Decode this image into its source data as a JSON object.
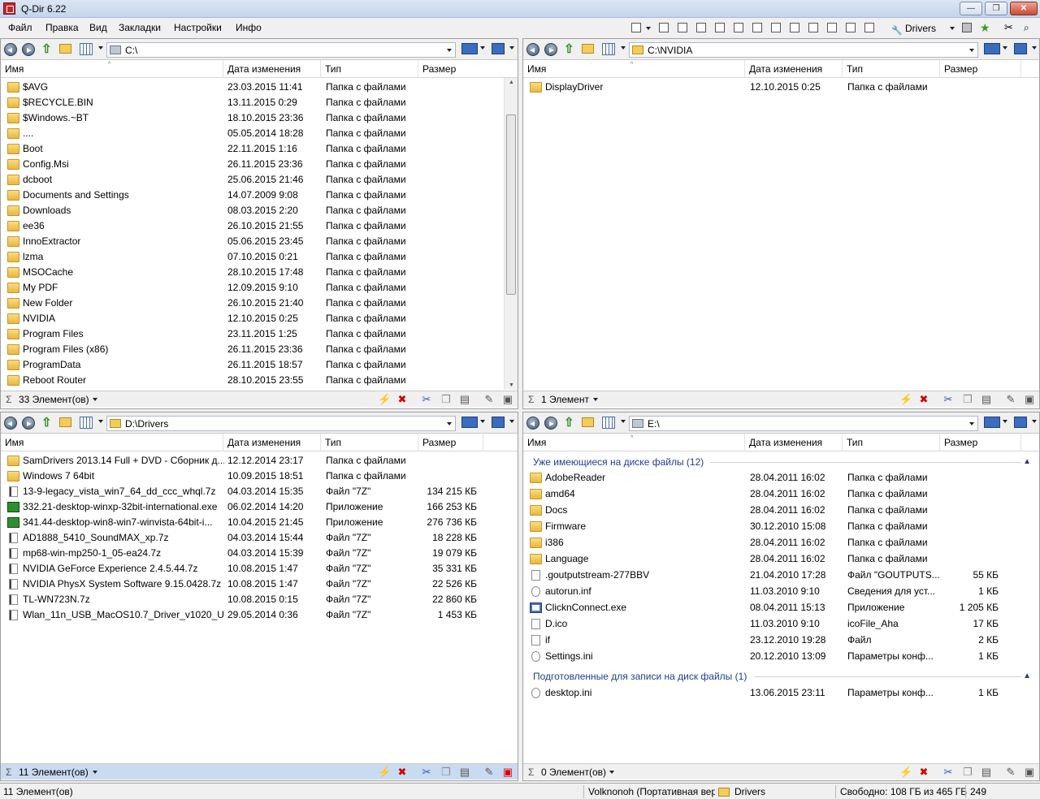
{
  "window": {
    "title": "Q-Dir 6.22"
  },
  "menu": {
    "items": [
      "Файл",
      "Правка",
      "Вид",
      "Закладки",
      "Настройки",
      "Инфо"
    ]
  },
  "toolbar": {
    "bookmark_label": "Drivers"
  },
  "columns": {
    "name": "Имя",
    "date": "Дата изменения",
    "type": "Тип",
    "size": "Размер"
  },
  "panels": {
    "top_left": {
      "path": "C:\\",
      "status": "33 Элемент(ов)",
      "rows": [
        {
          "name": "$AVG",
          "date": "23.03.2015 11:41",
          "type": "Папка с файлами",
          "size": "",
          "icon": "folder"
        },
        {
          "name": "$RECYCLE.BIN",
          "date": "13.11.2015 0:29",
          "type": "Папка с файлами",
          "size": "",
          "icon": "folder"
        },
        {
          "name": "$Windows.~BT",
          "date": "18.10.2015 23:36",
          "type": "Папка с файлами",
          "size": "",
          "icon": "folder"
        },
        {
          "name": "....",
          "date": "05.05.2014 18:28",
          "type": "Папка с файлами",
          "size": "",
          "icon": "folder"
        },
        {
          "name": "Boot",
          "date": "22.11.2015 1:16",
          "type": "Папка с файлами",
          "size": "",
          "icon": "folder"
        },
        {
          "name": "Config.Msi",
          "date": "26.11.2015 23:36",
          "type": "Папка с файлами",
          "size": "",
          "icon": "folder"
        },
        {
          "name": "dcboot",
          "date": "25.06.2015 21:46",
          "type": "Папка с файлами",
          "size": "",
          "icon": "folder"
        },
        {
          "name": "Documents and Settings",
          "date": "14.07.2009 9:08",
          "type": "Папка с файлами",
          "size": "",
          "icon": "folder"
        },
        {
          "name": "Downloads",
          "date": "08.03.2015 2:20",
          "type": "Папка с файлами",
          "size": "",
          "icon": "folder"
        },
        {
          "name": "ee36",
          "date": "26.10.2015 21:55",
          "type": "Папка с файлами",
          "size": "",
          "icon": "folder"
        },
        {
          "name": "InnoExtractor",
          "date": "05.06.2015 23:45",
          "type": "Папка с файлами",
          "size": "",
          "icon": "folder"
        },
        {
          "name": "lzma",
          "date": "07.10.2015 0:21",
          "type": "Папка с файлами",
          "size": "",
          "icon": "folder"
        },
        {
          "name": "MSOCache",
          "date": "28.10.2015 17:48",
          "type": "Папка с файлами",
          "size": "",
          "icon": "folder"
        },
        {
          "name": "My PDF",
          "date": "12.09.2015 9:10",
          "type": "Папка с файлами",
          "size": "",
          "icon": "folder"
        },
        {
          "name": "New Folder",
          "date": "26.10.2015 21:40",
          "type": "Папка с файлами",
          "size": "",
          "icon": "folder"
        },
        {
          "name": "NVIDIA",
          "date": "12.10.2015 0:25",
          "type": "Папка с файлами",
          "size": "",
          "icon": "folder"
        },
        {
          "name": "Program Files",
          "date": "23.11.2015 1:25",
          "type": "Папка с файлами",
          "size": "",
          "icon": "folder"
        },
        {
          "name": "Program Files (x86)",
          "date": "26.11.2015 23:36",
          "type": "Папка с файлами",
          "size": "",
          "icon": "folder"
        },
        {
          "name": "ProgramData",
          "date": "26.11.2015 18:57",
          "type": "Папка с файлами",
          "size": "",
          "icon": "folder"
        },
        {
          "name": "Reboot Router",
          "date": "28.10.2015 23:55",
          "type": "Папка с файлами",
          "size": "",
          "icon": "folder"
        }
      ]
    },
    "top_right": {
      "path": "C:\\NVIDIA",
      "status": "1 Элемент",
      "rows": [
        {
          "name": "DisplayDriver",
          "date": "12.10.2015 0:25",
          "type": "Папка с файлами",
          "size": "",
          "icon": "folder"
        }
      ]
    },
    "bottom_left": {
      "path": "D:\\Drivers",
      "status": "11 Элемент(ов)",
      "rows": [
        {
          "name": "SamDrivers 2013.14 Full + DVD - Сборник д...",
          "date": "12.12.2014 23:17",
          "type": "Папка с файлами",
          "size": "",
          "icon": "folder"
        },
        {
          "name": "Windows 7 64bit",
          "date": "10.09.2015 18:51",
          "type": "Папка с файлами",
          "size": "",
          "icon": "folder"
        },
        {
          "name": "13-9-legacy_vista_win7_64_dd_ccc_whql.7z",
          "date": "04.03.2014 15:35",
          "type": "Файл \"7Z\"",
          "size": "134 215 КБ",
          "icon": "7z"
        },
        {
          "name": "332.21-desktop-winxp-32bit-international.exe",
          "date": "06.02.2014 14:20",
          "type": "Приложение",
          "size": "166 253 КБ",
          "icon": "exe"
        },
        {
          "name": "341.44-desktop-win8-win7-winvista-64bit-i...",
          "date": "10.04.2015 21:45",
          "type": "Приложение",
          "size": "276 736 КБ",
          "icon": "exe"
        },
        {
          "name": "AD1888_5410_SoundMAX_xp.7z",
          "date": "04.03.2014 15:44",
          "type": "Файл \"7Z\"",
          "size": "18 228 КБ",
          "icon": "7z"
        },
        {
          "name": "mp68-win-mp250-1_05-ea24.7z",
          "date": "04.03.2014 15:39",
          "type": "Файл \"7Z\"",
          "size": "19 079 КБ",
          "icon": "7z"
        },
        {
          "name": "NVIDIA GeForce Experience 2.4.5.44.7z",
          "date": "10.08.2015 1:47",
          "type": "Файл \"7Z\"",
          "size": "35 331 КБ",
          "icon": "7z"
        },
        {
          "name": "NVIDIA PhysX System Software 9.15.0428.7z",
          "date": "10.08.2015 1:47",
          "type": "Файл \"7Z\"",
          "size": "22 526 КБ",
          "icon": "7z"
        },
        {
          "name": "TL-WN723N.7z",
          "date": "10.08.2015 0:15",
          "type": "Файл \"7Z\"",
          "size": "22 860 КБ",
          "icon": "7z"
        },
        {
          "name": "Wlan_11n_USB_MacOS10.7_Driver_v1020_UI_...",
          "date": "29.05.2014 0:36",
          "type": "Файл \"7Z\"",
          "size": "1 453 КБ",
          "icon": "7z"
        }
      ]
    },
    "bottom_right": {
      "path": "E:\\",
      "status": "0 Элемент(ов)",
      "group1": "Уже имеющиеся на диске файлы (12)",
      "group2": "Подготовленные для записи на диск файлы (1)",
      "rows": [
        {
          "name": "AdobeReader",
          "date": "28.04.2011 16:02",
          "type": "Папка с файлами",
          "size": "",
          "icon": "folder"
        },
        {
          "name": "amd64",
          "date": "28.04.2011 16:02",
          "type": "Папка с файлами",
          "size": "",
          "icon": "folder"
        },
        {
          "name": "Docs",
          "date": "28.04.2011 16:02",
          "type": "Папка с файлами",
          "size": "",
          "icon": "folder"
        },
        {
          "name": "Firmware",
          "date": "30.12.2010 15:08",
          "type": "Папка с файлами",
          "size": "",
          "icon": "folder"
        },
        {
          "name": "i386",
          "date": "28.04.2011 16:02",
          "type": "Папка с файлами",
          "size": "",
          "icon": "folder"
        },
        {
          "name": "Language",
          "date": "28.04.2011 16:02",
          "type": "Папка с файлами",
          "size": "",
          "icon": "folder"
        },
        {
          "name": ".goutputstream-277BBV",
          "date": "21.04.2010 17:28",
          "type": "Файл \"GOUTPUTS...",
          "size": "55 КБ",
          "icon": "file"
        },
        {
          "name": "autorun.inf",
          "date": "11.03.2010 9:10",
          "type": "Сведения для уст...",
          "size": "1 КБ",
          "icon": "ini"
        },
        {
          "name": "ClicknConnect.exe",
          "date": "08.04.2011 15:13",
          "type": "Приложение",
          "size": "1 205 КБ",
          "icon": "app"
        },
        {
          "name": "D.ico",
          "date": "11.03.2010 9:10",
          "type": "icoFile_Aha",
          "size": "17 КБ",
          "icon": "file"
        },
        {
          "name": "if",
          "date": "23.12.2010 19:28",
          "type": "Файл",
          "size": "2 КБ",
          "icon": "file"
        },
        {
          "name": "Settings.ini",
          "date": "20.12.2010 13:09",
          "type": "Параметры конф...",
          "size": "1 КБ",
          "icon": "ini"
        }
      ],
      "rows2": [
        {
          "name": "desktop.ini",
          "date": "13.06.2015 23:11",
          "type": "Параметры конф...",
          "size": "1 КБ",
          "icon": "ini"
        }
      ]
    }
  },
  "statusbar": {
    "left": "11 Элемент(ов)",
    "user": "Volknonoh (Портативная вер",
    "folder": "Drivers",
    "free": "Свободно: 108 ГБ из 465 ГБ",
    "num": "249"
  }
}
